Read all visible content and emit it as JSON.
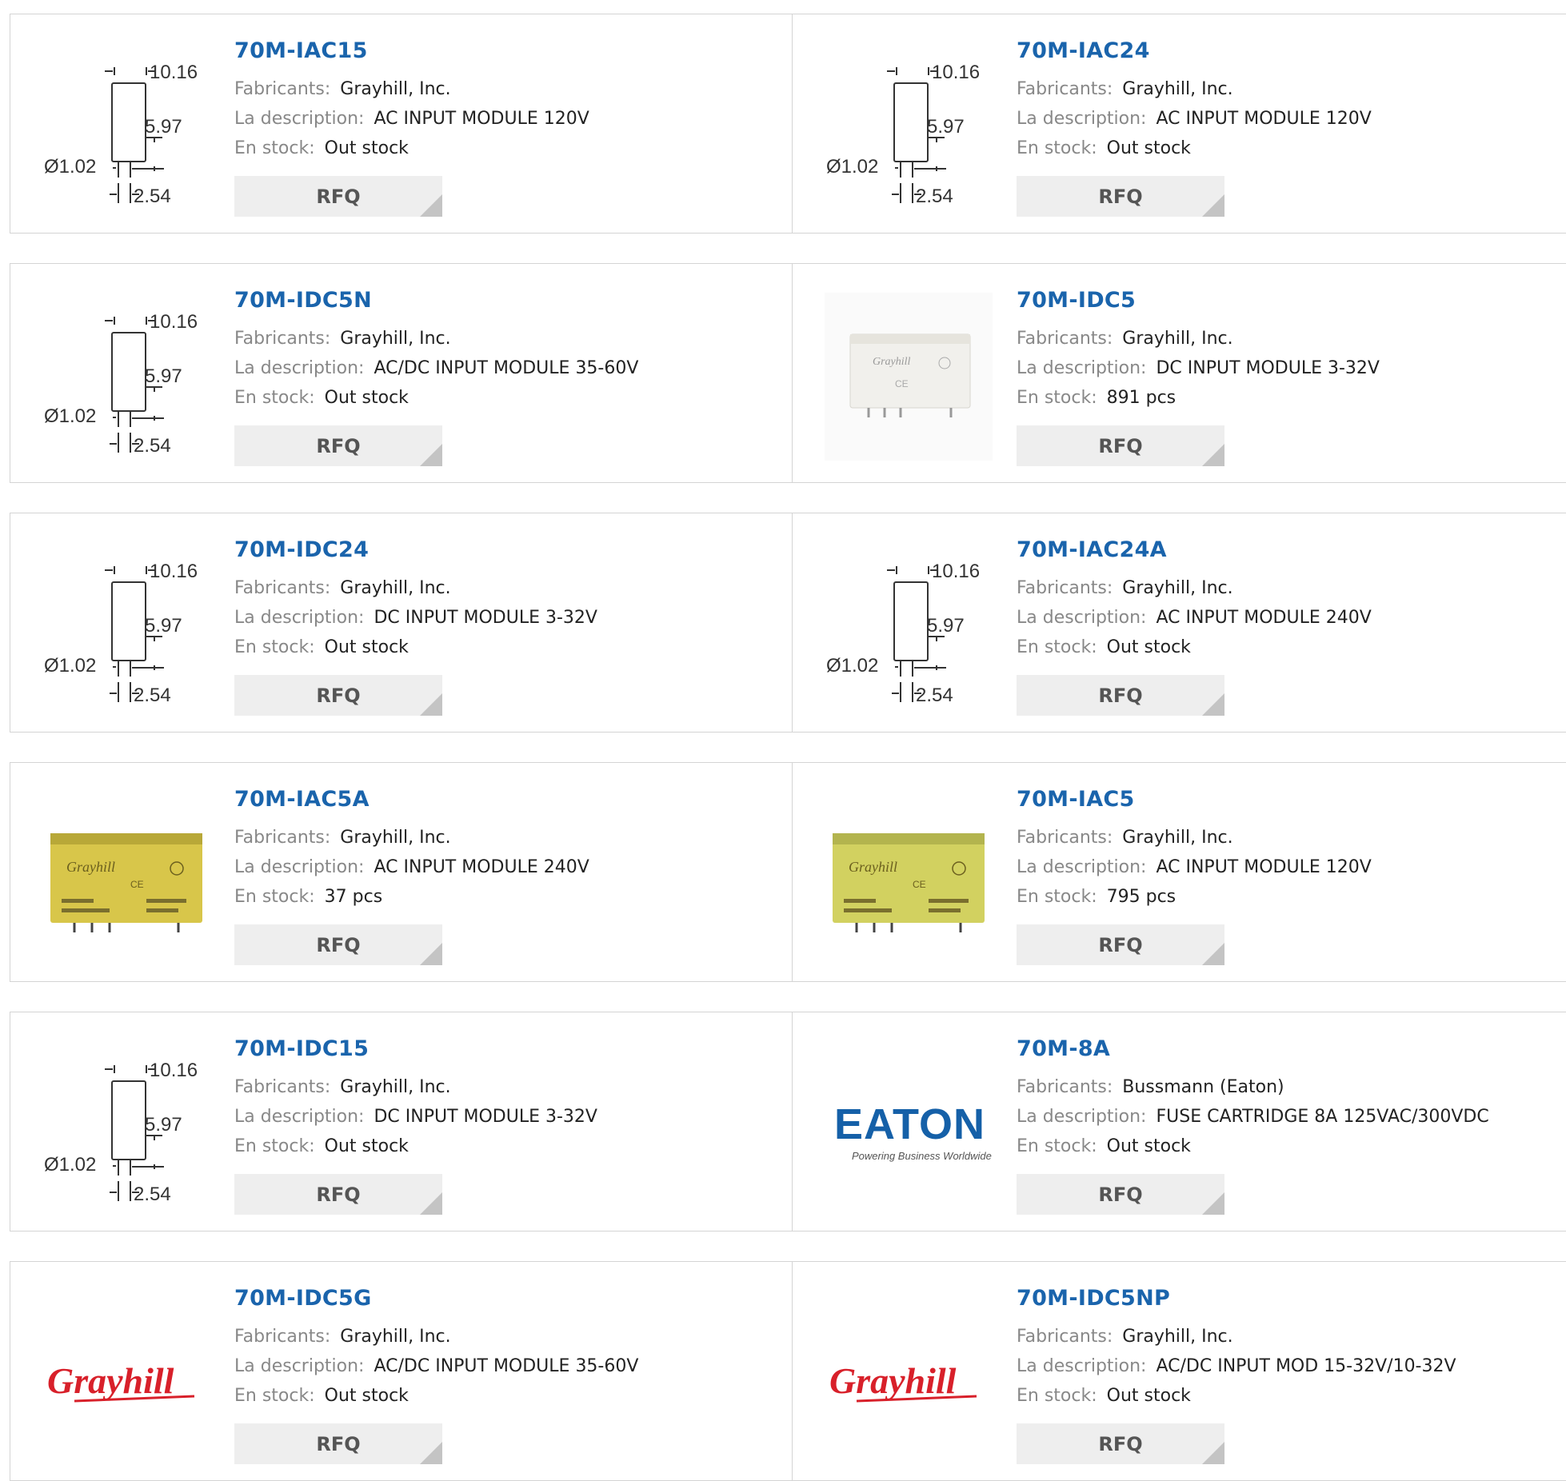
{
  "labels": {
    "manufacturer": "Fabricants:",
    "description": "La description:",
    "stock": "En stock:",
    "rfq": "RFQ"
  },
  "colors": {
    "part_link": "#1a64ac",
    "label": "#888888",
    "card_border": "#d4d4d4",
    "button_bg": "#eeeeee",
    "grayhill_red": "#d8202a",
    "eaton_blue": "#1560a8"
  },
  "drawing_labels": {
    "width": "10.16",
    "height": "5.97",
    "pin_diameter": "Ø1.02",
    "pin_pitch": "2.54"
  },
  "logo_text": {
    "grayhill": "Grayhill",
    "eaton": "EATON",
    "eaton_tagline": "Powering Business Worldwide"
  },
  "products": [
    {
      "part": "70M-IAC15",
      "manufacturer": "Grayhill, Inc.",
      "description": "AC INPUT MODULE 120V",
      "stock": "Out stock",
      "image": "dimension-drawing"
    },
    {
      "part": "70M-IAC24",
      "manufacturer": "Grayhill, Inc.",
      "description": "AC INPUT MODULE 120V",
      "stock": "Out stock",
      "image": "dimension-drawing"
    },
    {
      "part": "70M-IDC5N",
      "manufacturer": "Grayhill, Inc.",
      "description": "AC/DC INPUT MODULE 35-60V",
      "stock": "Out stock",
      "image": "dimension-drawing"
    },
    {
      "part": "70M-IDC5",
      "manufacturer": "Grayhill, Inc.",
      "description": "DC INPUT MODULE 3-32V",
      "stock": "891 pcs",
      "image": "module-white"
    },
    {
      "part": "70M-IDC24",
      "manufacturer": "Grayhill, Inc.",
      "description": "DC INPUT MODULE 3-32V",
      "stock": "Out stock",
      "image": "dimension-drawing"
    },
    {
      "part": "70M-IAC24A",
      "manufacturer": "Grayhill, Inc.",
      "description": "AC INPUT MODULE 240V",
      "stock": "Out stock",
      "image": "dimension-drawing"
    },
    {
      "part": "70M-IAC5A",
      "manufacturer": "Grayhill, Inc.",
      "description": "AC INPUT MODULE 240V",
      "stock": "37 pcs",
      "image": "module-yellow"
    },
    {
      "part": "70M-IAC5",
      "manufacturer": "Grayhill, Inc.",
      "description": "AC INPUT MODULE 120V",
      "stock": "795 pcs",
      "image": "module-yellow-light"
    },
    {
      "part": "70M-IDC15",
      "manufacturer": "Grayhill, Inc.",
      "description": "DC INPUT MODULE 3-32V",
      "stock": "Out stock",
      "image": "dimension-drawing"
    },
    {
      "part": "70M-8A",
      "manufacturer": "Bussmann (Eaton)",
      "description": "FUSE CARTRIDGE 8A 125VAC/300VDC",
      "stock": "Out stock",
      "image": "eaton-logo"
    },
    {
      "part": "70M-IDC5G",
      "manufacturer": "Grayhill, Inc.",
      "description": "AC/DC INPUT MODULE 35-60V",
      "stock": "Out stock",
      "image": "grayhill-logo"
    },
    {
      "part": "70M-IDC5NP",
      "manufacturer": "Grayhill, Inc.",
      "description": "AC/DC INPUT MOD 15-32V/10-32V",
      "stock": "Out stock",
      "image": "grayhill-logo"
    }
  ]
}
